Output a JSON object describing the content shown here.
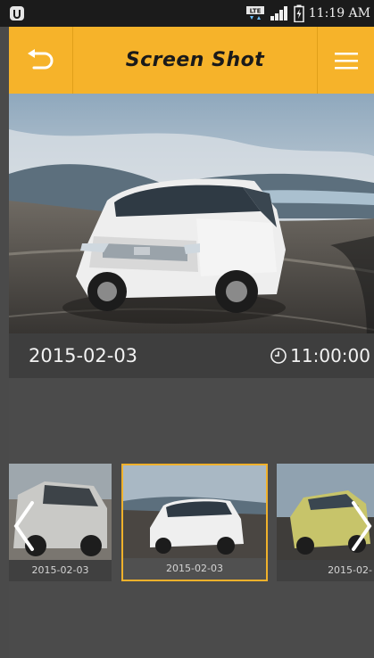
{
  "status_bar": {
    "network": "LTE",
    "time": "11:19 AM"
  },
  "header": {
    "title": "Screen Shot",
    "back_icon": "back-arrow-icon",
    "menu_icon": "hamburger-menu-icon"
  },
  "photo": {
    "date": "2015-02-03",
    "time": "11:00:00"
  },
  "filmstrip": {
    "items": [
      {
        "caption": "2015-02-03"
      },
      {
        "caption": "2015-02-03"
      },
      {
        "caption": "2015-02-"
      }
    ],
    "selected_index": 1
  },
  "colors": {
    "accent": "#f6b32a",
    "background": "#4a4a4a",
    "status_bar": "#1b1b1b"
  }
}
